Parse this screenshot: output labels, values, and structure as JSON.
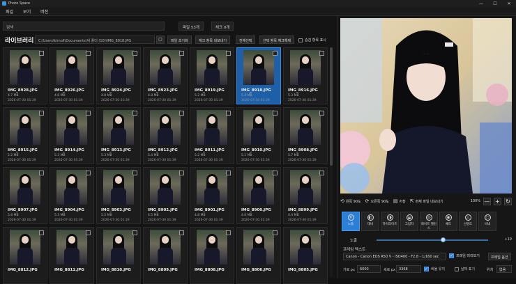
{
  "window": {
    "title": "Photo Space",
    "minimize": "—",
    "maximize": "☐",
    "close": "✕"
  },
  "menu": [
    "파일",
    "보기",
    "버전"
  ],
  "search": {
    "value": "검색"
  },
  "counts": {
    "files": "파일 53개",
    "checked": "체크 0개"
  },
  "library": {
    "title": "라이브러리",
    "path": "C:\\Users\\kimoll\\Documents\\새 폴더 (10)\\IMG_8918.JPG",
    "buttons": [
      "파일 초기화",
      "체크 항목 내보내기",
      "전체선택",
      "선택 항목 체크해제"
    ],
    "show_checked_label": "숨김 항목 표시"
  },
  "photos": [
    {
      "name": "IMG_8928.JPG",
      "size": "4.7 MB",
      "date": "2026-07-30 01:39",
      "selected": false
    },
    {
      "name": "IMG_8926.JPG",
      "size": "4.8 MB",
      "date": "2026-07-30 01:39",
      "selected": false
    },
    {
      "name": "IMG_8924.JPG",
      "size": "4.8 MB",
      "date": "2026-07-30 01:39",
      "selected": false
    },
    {
      "name": "IMG_8923.JPG",
      "size": "4.8 MB",
      "date": "2026-07-30 01:39",
      "selected": false
    },
    {
      "name": "IMG_8919.JPG",
      "size": "5.2 MB",
      "date": "2026-07-30 01:39",
      "selected": false
    },
    {
      "name": "IMG_8918.JPG",
      "size": "5.4 MB",
      "date": "2026-07-30 01:39",
      "selected": true
    },
    {
      "name": "IMG_8916.JPG",
      "size": "5.3 MB",
      "date": "2026-07-30 01:39",
      "selected": false
    },
    {
      "name": "IMG_8915.JPG",
      "size": "5.2 MB",
      "date": "2026-07-30 01:39",
      "selected": false
    },
    {
      "name": "IMG_8914.JPG",
      "size": "5.3 MB",
      "date": "2026-07-30 01:39",
      "selected": false
    },
    {
      "name": "IMG_8913.JPG",
      "size": "5.3 MB",
      "date": "2026-07-30 01:39",
      "selected": false
    },
    {
      "name": "IMG_8912.JPG",
      "size": "5.4 MB",
      "date": "2026-07-30 01:39",
      "selected": false
    },
    {
      "name": "IMG_8911.JPG",
      "size": "5.2 MB",
      "date": "2026-07-30 01:39",
      "selected": false
    },
    {
      "name": "IMG_8910.JPG",
      "size": "5.1 MB",
      "date": "2026-07-30 01:39",
      "selected": false
    },
    {
      "name": "IMG_8908.JPG",
      "size": "5.7 MB",
      "date": "2026-07-30 01:39",
      "selected": false
    },
    {
      "name": "IMG_8907.JPG",
      "size": "5.8 MB",
      "date": "2026-07-30 01:39",
      "selected": false
    },
    {
      "name": "IMG_8904.JPG",
      "size": "5.3 MB",
      "date": "2026-07-30 01:39",
      "selected": false
    },
    {
      "name": "IMG_8903.JPG",
      "size": "5.5 MB",
      "date": "2026-07-30 01:39",
      "selected": false
    },
    {
      "name": "IMG_8902.JPG",
      "size": "4.5 MB",
      "date": "2026-07-30 01:39",
      "selected": false
    },
    {
      "name": "IMG_8901.JPG",
      "size": "4.8 MB",
      "date": "2026-07-30 01:39",
      "selected": false
    },
    {
      "name": "IMG_8900.JPG",
      "size": "4.6 MB",
      "date": "2026-07-30 01:39",
      "selected": false
    },
    {
      "name": "IMG_8899.JPG",
      "size": "4.4 MB",
      "date": "2026-07-30 01:39",
      "selected": false
    },
    {
      "name": "IMG_8812.JPG",
      "size": "",
      "date": "",
      "selected": false
    },
    {
      "name": "IMG_8811.JPG",
      "size": "",
      "date": "",
      "selected": false
    },
    {
      "name": "IMG_8810.JPG",
      "size": "",
      "date": "",
      "selected": false
    },
    {
      "name": "IMG_8809.JPG",
      "size": "",
      "date": "",
      "selected": false
    },
    {
      "name": "IMG_8808.JPG",
      "size": "",
      "date": "",
      "selected": false
    },
    {
      "name": "IMG_8806.JPG",
      "size": "",
      "date": "",
      "selected": false
    },
    {
      "name": "IMG_8805.JPG",
      "size": "",
      "date": "",
      "selected": false
    }
  ],
  "preview_controls": {
    "rotate_left": "왼쪽 90도",
    "rotate_right": "오른쪽 90도",
    "save": "저장",
    "export_current": "현재 파일 내보내기",
    "zoom": "100%",
    "zoom_out": "—",
    "zoom_in": "+",
    "reset": "↻"
  },
  "tools": [
    {
      "label": "노출",
      "active": true
    },
    {
      "label": "대비",
      "active": false
    },
    {
      "label": "하이라이트",
      "active": false
    },
    {
      "label": "그림자",
      "active": false
    },
    {
      "label": "화이트 밸런스",
      "active": false
    },
    {
      "label": "채도",
      "active": false
    },
    {
      "label": "선명도",
      "active": false
    },
    {
      "label": "비네",
      "active": false
    }
  ],
  "exposure": {
    "label": "노출",
    "value": "+19",
    "level": 0.595
  },
  "frame": {
    "title": "프레임 텍스트",
    "text": "Canon - Canon EOS R50 V - ISO400 - F2.8 - 1/160 sec",
    "preview_label": "프레임 미리보기",
    "options_label": "프레임 옵션"
  },
  "dimensions": {
    "width_label": "가로 px",
    "width": "6000",
    "height_label": "세로 px",
    "height": "3368",
    "keep_ratio_label": "비율 유지",
    "date_label": "날짜 표기",
    "position_label": "위치",
    "position_value": "없음"
  },
  "colors": {
    "accent": "#2c7fd6",
    "selected_card": "#1e5fa8"
  }
}
